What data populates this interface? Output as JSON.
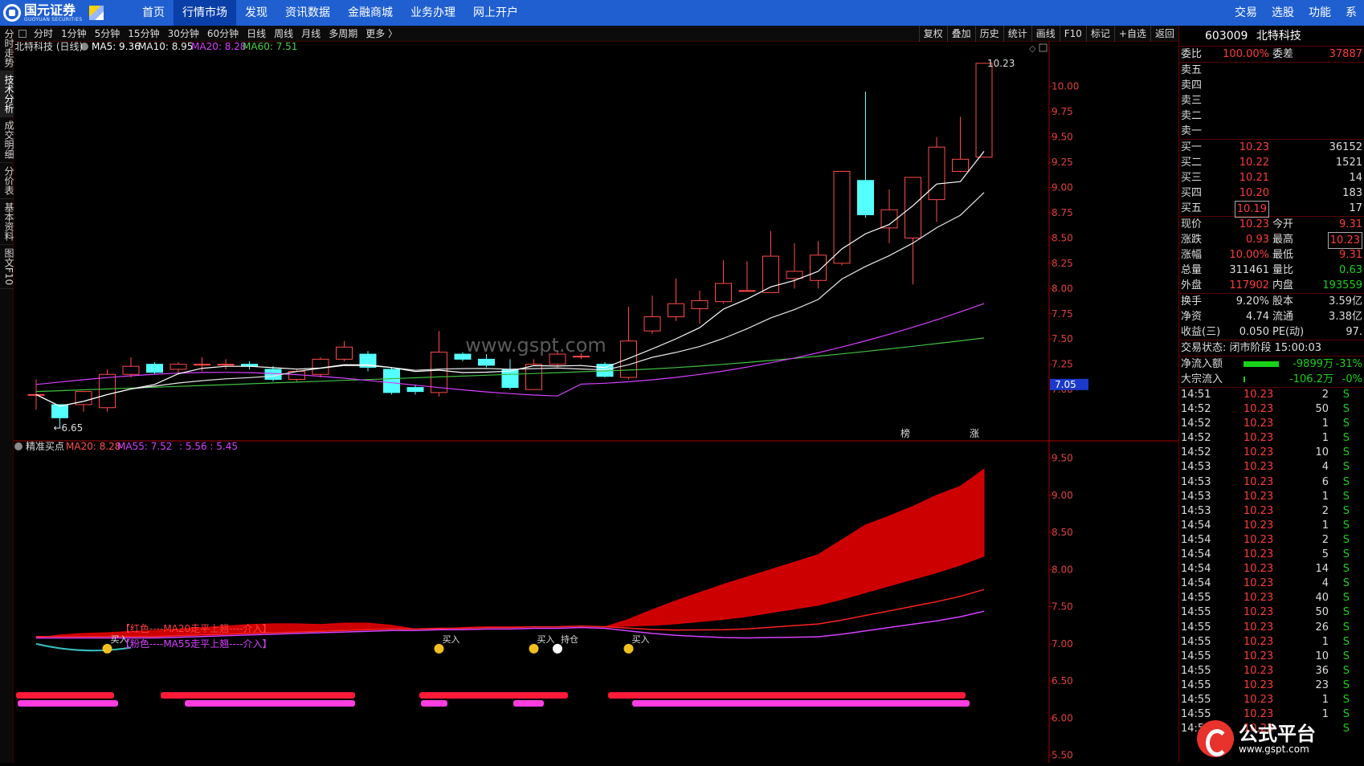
{
  "app": {
    "name_cn": "国元证券",
    "name_en": "GUOYUAN SECURITIES"
  },
  "nav": [
    "首页",
    "行情市场",
    "发现",
    "资讯数据",
    "金融商城",
    "业务办理",
    "网上开户"
  ],
  "nav_active": 1,
  "right_nav": [
    "交易",
    "选股",
    "功能",
    "系"
  ],
  "vtabs": [
    "分时走势",
    "技术分析",
    "成交明细",
    "分价表",
    "基本资料",
    "图文F10"
  ],
  "vtab_active": 1,
  "periods": [
    "分时",
    "1分钟",
    "5分钟",
    "15分钟",
    "30分钟",
    "60分钟",
    "日线",
    "周线",
    "月线",
    "多周期",
    "更多 〉"
  ],
  "tools": [
    "复权",
    "叠加",
    "历史",
    "统计",
    "画线",
    "F10",
    "标记",
    "+自选",
    "返回"
  ],
  "main_legend": {
    "stock": "北特科技 (日线)",
    "ma5": "MA5: 9.36",
    "ma10": "MA10: 8.95",
    "ma20": "MA20: 8.28",
    "ma60": "MA60: 7.51"
  },
  "sub_legend": {
    "name": "精准买点",
    "ma20": "MA20: 8.28",
    "ma55": "MA55: 7.52",
    "ratio": ": 5.56 : 5.45"
  },
  "chart_data": [
    {
      "type": "candlestick",
      "title": "北特科技 (日线)",
      "y_ticks": [
        "10.00",
        "9.75",
        "9.50",
        "9.25",
        "9.00",
        "8.75",
        "8.50",
        "8.25",
        "8.00",
        "7.75",
        "7.50",
        "7.25",
        "7.00"
      ],
      "ylim": [
        6.5,
        10.3
      ],
      "ohlc": [
        [
          6.95,
          7.1,
          6.8,
          6.95
        ],
        [
          6.85,
          6.85,
          6.62,
          6.72
        ],
        [
          6.85,
          6.95,
          6.78,
          6.98
        ],
        [
          6.82,
          7.2,
          6.78,
          7.15
        ],
        [
          7.15,
          7.32,
          7.12,
          7.23
        ],
        [
          7.25,
          7.27,
          7.15,
          7.17
        ],
        [
          7.2,
          7.27,
          7.15,
          7.25
        ],
        [
          7.25,
          7.32,
          7.18,
          7.25
        ],
        [
          7.25,
          7.3,
          7.2,
          7.25
        ],
        [
          7.25,
          7.28,
          7.2,
          7.23
        ],
        [
          7.2,
          7.23,
          7.08,
          7.1
        ],
        [
          7.1,
          7.2,
          7.08,
          7.18
        ],
        [
          7.15,
          7.32,
          7.12,
          7.3
        ],
        [
          7.3,
          7.48,
          7.28,
          7.42
        ],
        [
          7.35,
          7.38,
          7.18,
          7.22
        ],
        [
          7.2,
          7.22,
          6.95,
          6.97
        ],
        [
          7.02,
          7.05,
          6.95,
          6.98
        ],
        [
          6.97,
          7.58,
          6.93,
          7.37
        ],
        [
          7.35,
          7.37,
          7.28,
          7.3
        ],
        [
          7.3,
          7.35,
          7.22,
          7.24
        ],
        [
          7.2,
          7.3,
          7.0,
          7.02
        ],
        [
          7.0,
          7.3,
          7.0,
          7.25
        ],
        [
          7.25,
          7.38,
          7.22,
          7.35
        ],
        [
          7.33,
          7.36,
          7.3,
          7.33
        ],
        [
          7.25,
          7.27,
          7.12,
          7.13
        ],
        [
          7.12,
          7.82,
          7.1,
          7.48
        ],
        [
          7.58,
          7.93,
          7.55,
          7.72
        ],
        [
          7.72,
          8.1,
          7.68,
          7.85
        ],
        [
          7.8,
          7.98,
          7.65,
          7.88
        ],
        [
          7.87,
          8.28,
          7.85,
          8.05
        ],
        [
          7.98,
          8.27,
          7.98,
          7.98
        ],
        [
          7.96,
          8.57,
          7.96,
          8.32
        ],
        [
          8.1,
          8.45,
          8.0,
          8.17
        ],
        [
          8.08,
          8.47,
          8.0,
          8.33
        ],
        [
          8.25,
          9.16,
          8.23,
          9.16
        ],
        [
          9.07,
          9.95,
          8.7,
          8.73
        ],
        [
          8.6,
          8.98,
          8.45,
          8.78
        ],
        [
          8.5,
          9.1,
          8.04,
          9.1
        ],
        [
          8.88,
          9.5,
          8.66,
          9.4
        ],
        [
          9.16,
          9.7,
          9.15,
          9.28
        ],
        [
          9.3,
          10.23,
          9.3,
          10.23
        ]
      ],
      "highest": "10.23",
      "lowest": "6.65",
      "current_tag": "7.05",
      "markers": [
        "榜",
        "涨"
      ],
      "watermark": "www.gspt.com",
      "series": [
        {
          "name": "MA5"
        },
        {
          "name": "MA10"
        },
        {
          "name": "MA20"
        },
        {
          "name": "MA60"
        }
      ]
    },
    {
      "type": "area",
      "title": "精准买点",
      "y_ticks": [
        "9.50",
        "9.00",
        "8.50",
        "8.00",
        "7.50",
        "7.00",
        "6.50",
        "6.00",
        "5.50"
      ],
      "ylim": [
        5.4,
        9.7
      ],
      "band": [
        [
          7.08,
          7.1
        ],
        [
          7.12,
          7.1
        ],
        [
          7.14,
          7.1
        ],
        [
          7.15,
          7.1
        ],
        [
          7.17,
          7.1
        ],
        [
          7.18,
          7.1
        ],
        [
          7.2,
          7.11
        ],
        [
          7.22,
          7.12
        ],
        [
          7.24,
          7.13
        ],
        [
          7.26,
          7.14
        ],
        [
          7.27,
          7.15
        ],
        [
          7.27,
          7.16
        ],
        [
          7.26,
          7.17
        ],
        [
          7.28,
          7.18
        ],
        [
          7.28,
          7.19
        ],
        [
          7.25,
          7.2
        ],
        [
          7.2,
          7.2
        ],
        [
          7.2,
          7.21
        ],
        [
          7.22,
          7.21
        ],
        [
          7.23,
          7.22
        ],
        [
          7.23,
          7.22
        ],
        [
          7.23,
          7.23
        ],
        [
          7.23,
          7.23
        ],
        [
          7.24,
          7.24
        ],
        [
          7.23,
          7.23
        ],
        [
          7.33,
          7.24
        ],
        [
          7.46,
          7.25
        ],
        [
          7.58,
          7.27
        ],
        [
          7.69,
          7.3
        ],
        [
          7.8,
          7.33
        ],
        [
          7.9,
          7.37
        ],
        [
          8.0,
          7.42
        ],
        [
          8.1,
          7.47
        ],
        [
          8.2,
          7.52
        ],
        [
          8.4,
          7.6
        ],
        [
          8.6,
          7.69
        ],
        [
          8.72,
          7.78
        ],
        [
          8.85,
          7.87
        ],
        [
          9.0,
          7.96
        ],
        [
          9.12,
          8.06
        ],
        [
          9.35,
          8.18
        ]
      ],
      "buy_labels": [
        "买入",
        "买入",
        "买入",
        "持仓",
        "买入"
      ],
      "notes": [
        "【红色----MA20走平上翘----介入】",
        "【粉色----MA55走平上翘----介入】"
      ]
    }
  ],
  "colors": {
    "up": "#ff4a4a",
    "down": "#54ffff",
    "ma5": "#ffffff",
    "ma10": "#e6e6e6",
    "ma20": "#d640ff",
    "ma60": "#40c040",
    "band": "#cc0000",
    "axis": "#aa0000",
    "bar_red": "#ff1a3a",
    "bar_pink": "#ff3de0"
  },
  "quote": {
    "code": "603009",
    "name": "北特科技",
    "webi": {
      "label": "委比",
      "value": "100.00%",
      "label2": "委差",
      "value2": "37887"
    },
    "sell": [
      {
        "l": "卖五"
      },
      {
        "l": "卖四"
      },
      {
        "l": "卖三"
      },
      {
        "l": "卖二"
      },
      {
        "l": "卖一"
      }
    ],
    "buy": [
      {
        "l": "买一",
        "p": "10.23",
        "v": "36152"
      },
      {
        "l": "买二",
        "p": "10.22",
        "v": "1521"
      },
      {
        "l": "买三",
        "p": "10.21",
        "v": "14"
      },
      {
        "l": "买四",
        "p": "10.20",
        "v": "183"
      },
      {
        "l": "买五",
        "p": "10.19",
        "v": "17"
      }
    ],
    "stats": [
      [
        "现价",
        "10.23",
        "今开",
        "9.31"
      ],
      [
        "涨跌",
        "0.93",
        "最高",
        "10.23"
      ],
      [
        "涨幅",
        "10.00%",
        "最低",
        "9.31"
      ],
      [
        "总量",
        "311461",
        "量比",
        "0.63"
      ],
      [
        "外盘",
        "117902",
        "内盘",
        "193559"
      ]
    ],
    "stats2": [
      [
        "换手",
        "9.20%",
        "股本",
        "3.59亿"
      ],
      [
        "净资",
        "4.74",
        "流通",
        "3.38亿"
      ],
      [
        "收益(三)",
        "0.050",
        "PE(动)",
        "97."
      ]
    ],
    "status": "交易状态: 闭市阶段 15:00:03",
    "flow": [
      {
        "l": "净流入额",
        "v": "-9899万",
        "p": "-31%"
      },
      {
        "l": "大宗流入",
        "v": "-106.2万",
        "p": "-0%"
      }
    ],
    "ticks": [
      [
        "14:51",
        "10.23",
        "2",
        "S"
      ],
      [
        "14:52",
        "10.23",
        "50",
        "S"
      ],
      [
        "14:52",
        "10.23",
        "1",
        "S"
      ],
      [
        "14:52",
        "10.23",
        "1",
        "S"
      ],
      [
        "14:52",
        "10.23",
        "10",
        "S"
      ],
      [
        "14:53",
        "10.23",
        "4",
        "S"
      ],
      [
        "14:53",
        "10.23",
        "6",
        "S"
      ],
      [
        "14:53",
        "10.23",
        "1",
        "S"
      ],
      [
        "14:53",
        "10.23",
        "2",
        "S"
      ],
      [
        "14:54",
        "10.23",
        "1",
        "S"
      ],
      [
        "14:54",
        "10.23",
        "2",
        "S"
      ],
      [
        "14:54",
        "10.23",
        "5",
        "S"
      ],
      [
        "14:54",
        "10.23",
        "14",
        "S"
      ],
      [
        "14:54",
        "10.23",
        "4",
        "S"
      ],
      [
        "14:55",
        "10.23",
        "40",
        "S"
      ],
      [
        "14:55",
        "10.23",
        "50",
        "S"
      ],
      [
        "14:55",
        "10.23",
        "26",
        "S"
      ],
      [
        "14:55",
        "10.23",
        "1",
        "S"
      ],
      [
        "14:55",
        "10.23",
        "10",
        "S"
      ],
      [
        "14:55",
        "10.23",
        "36",
        "S"
      ],
      [
        "14:55",
        "10.23",
        "23",
        "S"
      ],
      [
        "14:55",
        "10.23",
        "1",
        "S"
      ],
      [
        "14:55",
        "10.23",
        "1",
        "S"
      ],
      [
        "14:56",
        "10.23",
        "",
        "S"
      ]
    ]
  },
  "watermark2": {
    "t1": "公式平台",
    "t2": "www.gspt.com"
  }
}
